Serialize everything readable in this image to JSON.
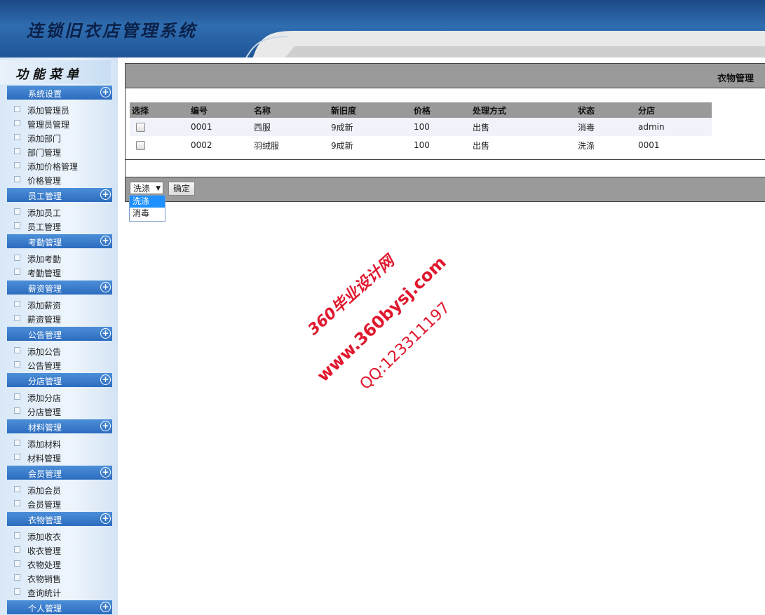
{
  "header": {
    "app_title": "连锁旧衣店管理系统"
  },
  "sidebar": {
    "menu_title": "功能菜单",
    "groups": [
      {
        "label": "系统设置",
        "items": [
          "添加管理员",
          "管理员管理",
          "添加部门",
          "部门管理",
          "添加价格管理",
          "价格管理"
        ]
      },
      {
        "label": "员工管理",
        "items": [
          "添加员工",
          "员工管理"
        ]
      },
      {
        "label": "考勤管理",
        "items": [
          "添加考勤",
          "考勤管理"
        ]
      },
      {
        "label": "薪资管理",
        "items": [
          "添加薪资",
          "薪资管理"
        ]
      },
      {
        "label": "公告管理",
        "items": [
          "添加公告",
          "公告管理"
        ]
      },
      {
        "label": "分店管理",
        "items": [
          "添加分店",
          "分店管理"
        ]
      },
      {
        "label": "材料管理",
        "items": [
          "添加材料",
          "材料管理"
        ]
      },
      {
        "label": "会员管理",
        "items": [
          "添加会员",
          "会员管理"
        ]
      },
      {
        "label": "衣物管理",
        "items": [
          "添加收衣",
          "收衣管理",
          "衣物处理",
          "衣物销售",
          "查询统计"
        ]
      },
      {
        "label": "个人管理",
        "items": []
      }
    ]
  },
  "main": {
    "title": "衣物管理",
    "table": {
      "headers": [
        "选择",
        "编号",
        "名称",
        "新旧度",
        "价格",
        "处理方式",
        "状态",
        "分店"
      ],
      "rows": [
        [
          "",
          "0001",
          "西服",
          "9成新",
          "100",
          "出售",
          "消毒",
          "admin"
        ],
        [
          "",
          "0002",
          "羽绒服",
          "9成新",
          "100",
          "出售",
          "洗涤",
          "0001"
        ]
      ]
    },
    "action": {
      "select_value": "洗涤",
      "options": [
        "洗涤",
        "消毒"
      ],
      "confirm_label": "确定"
    }
  },
  "watermark": {
    "line1": "360毕业设计网",
    "line2": "www.360bysj.com",
    "line3": "QQ:123311197"
  }
}
